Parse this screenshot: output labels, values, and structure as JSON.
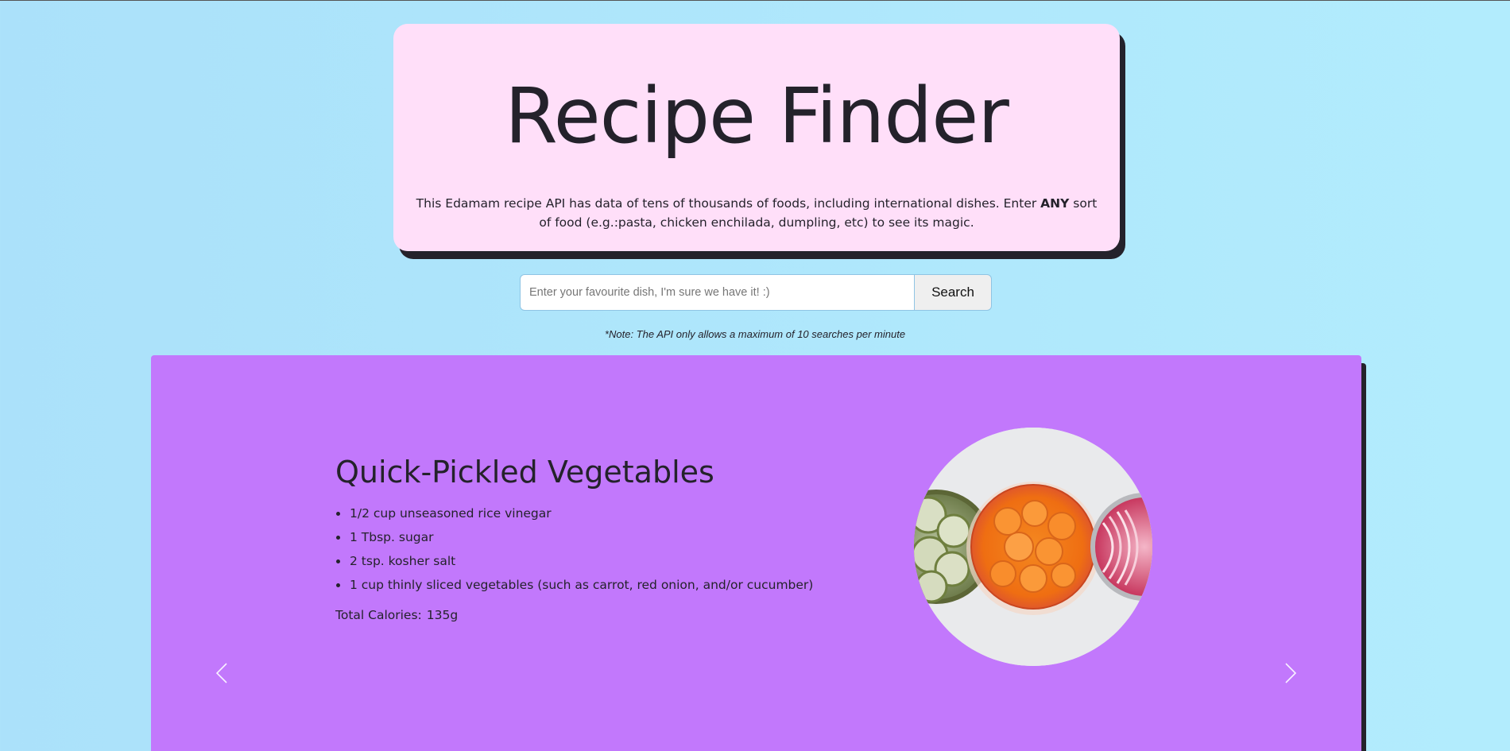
{
  "header": {
    "title": "Recipe Finder",
    "intro_before": "This Edamam recipe API has data of tens of thousands of foods, including international dishes. Enter ",
    "intro_bold": "ANY",
    "intro_after": " sort of food (e.g.:pasta, chicken enchilada, dumpling, etc) to see its magic."
  },
  "search": {
    "placeholder": "Enter your favourite dish, I'm sure we have it! :)",
    "value": "",
    "button_label": "Search",
    "note": "*Note: The API only allows a maximum of 10 searches per minute"
  },
  "recipe": {
    "title": "Quick-Pickled Vegetables",
    "ingredients": [
      "1/2 cup unseasoned rice vinegar",
      "1 Tbsp. sugar",
      "2 tsp. kosher salt",
      "1 cup thinly sliced vegetables (such as carrot, red onion, and/or cucumber)"
    ],
    "calories_label": "Total Calories:",
    "calories_value": "135g"
  },
  "carousel": {
    "prev_icon": "chevron-left-icon",
    "next_icon": "chevron-right-icon"
  },
  "colors": {
    "background": "#b2ecfd",
    "header_card": "#ffdff9",
    "carousel": "#c278fc",
    "text": "#24222b"
  }
}
